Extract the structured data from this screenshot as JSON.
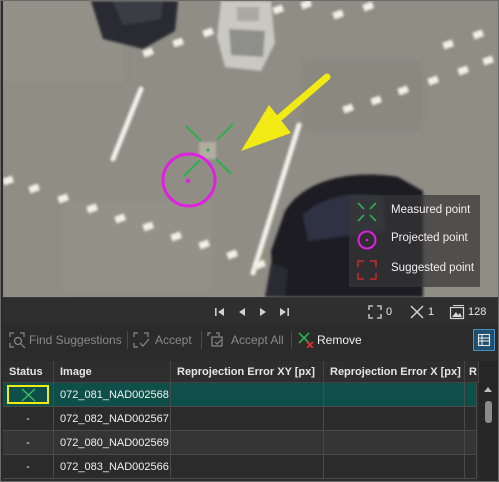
{
  "legend": {
    "measured": "Measured point",
    "projected": "Projected point",
    "suggested": "Suggested point"
  },
  "stats": {
    "suggested_count": "0",
    "measured_count": "1",
    "image_count": "128"
  },
  "toolbar": {
    "find_suggestions": "Find Suggestions",
    "accept": "Accept",
    "accept_all": "Accept All",
    "remove": "Remove"
  },
  "table": {
    "columns": [
      "Status",
      "Image",
      "Reprojection Error XY [px]",
      "Reprojection Error X [px]",
      "R"
    ],
    "rows": [
      {
        "status": "",
        "status_icon": "measured-x-icon",
        "image": "072_081_NAD002568",
        "err_xy": "",
        "err_x": ""
      },
      {
        "status": "-",
        "image": "072_082_NAD002567",
        "err_xy": "",
        "err_x": ""
      },
      {
        "status": "-",
        "image": "072_080_NAD002569",
        "err_xy": "",
        "err_x": ""
      },
      {
        "status": "-",
        "image": "072_083_NAD002566",
        "err_xy": "",
        "err_x": ""
      }
    ]
  },
  "colors": {
    "measured": "#2fae4e",
    "projected": "#e020e0",
    "suggested": "#c8282a",
    "annotation_arrow": "#f2ea14",
    "selected_row": "#0f4f4a"
  }
}
